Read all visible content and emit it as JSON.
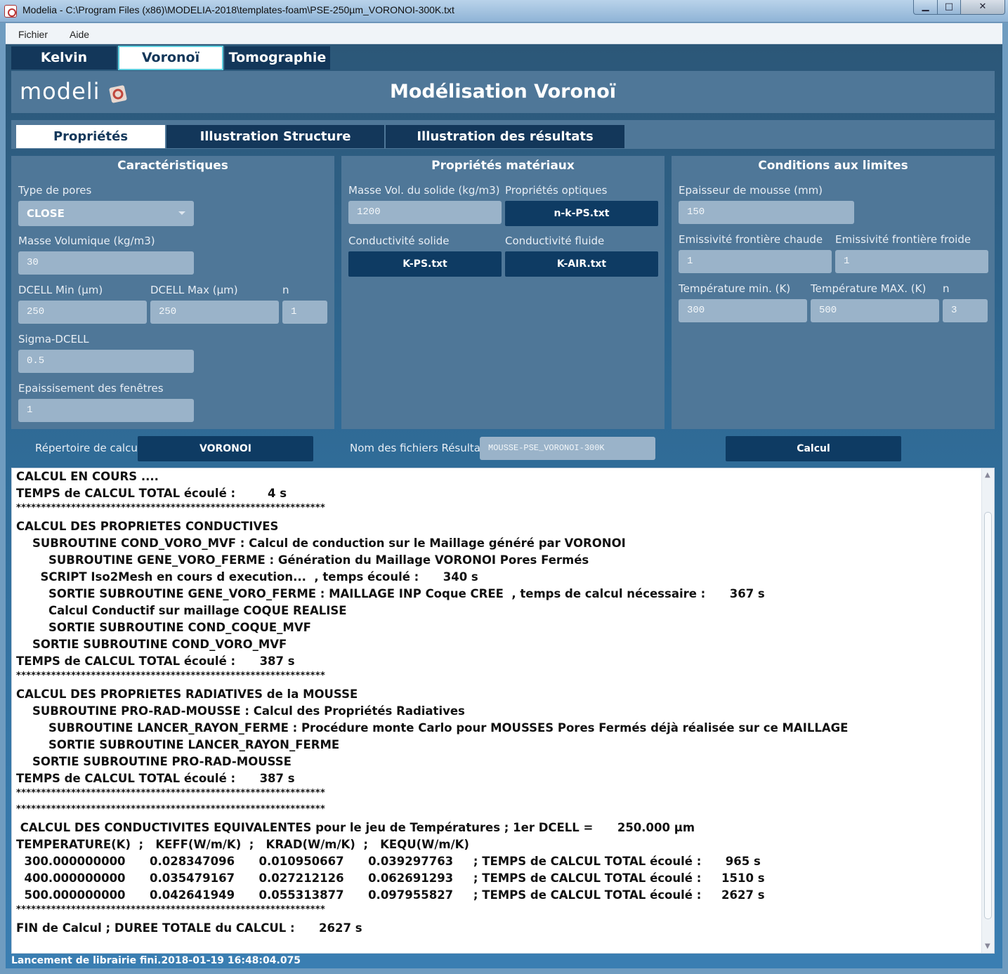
{
  "window": {
    "title": "Modelia - C:\\Program Files (x86)\\MODELIA-2018\\templates-foam\\PSE-250µm_VORONOI-300K.txt",
    "minimize": "▁",
    "maximize": "□",
    "close": "✕"
  },
  "menu": {
    "fichier": "Fichier",
    "aide": "Aide"
  },
  "top_tabs": {
    "kelvin": "Kelvin",
    "voronoi": "Voronoï",
    "tomographie": "Tomographie"
  },
  "header": {
    "logo_text": "modelia",
    "title": "Modélisation Voronoï"
  },
  "inner_tabs": {
    "proprietes": "Propriétés",
    "illustration_structure": "Illustration Structure",
    "illustration_resultats": "Illustration des résultats"
  },
  "caracteristiques": {
    "title": "Caractéristiques",
    "type_pores_label": "Type de pores",
    "type_pores_value": "CLOSE",
    "masse_vol_label": "Masse Volumique (kg/m3)",
    "masse_vol_value": "30",
    "dcell_min_label": "DCELL Min (µm)",
    "dcell_min_value": "250",
    "dcell_max_label": "DCELL Max (µm)",
    "dcell_max_value": "250",
    "n_label": "n",
    "n_value": "1",
    "sigma_label": "Sigma-DCELL",
    "sigma_value": "0.5",
    "epaississement_label": "Epaissisement des fenêtres",
    "epaississement_value": "1"
  },
  "materiaux": {
    "title": "Propriétés matériaux",
    "masse_vol_solide_label": "Masse Vol. du solide (kg/m3)",
    "masse_vol_solide_value": "1200",
    "optiques_label": "Propriétés optiques",
    "optiques_button": "n-k-PS.txt",
    "cond_solide_label": "Conductivité solide",
    "cond_solide_button": "K-PS.txt",
    "cond_fluide_label": "Conductivité fluide",
    "cond_fluide_button": "K-AIR.txt"
  },
  "conditions": {
    "title": "Conditions aux limites",
    "epaisseur_label": "Epaisseur de mousse (mm)",
    "epaisseur_value": "150",
    "emis_chaude_label": "Emissivité frontière chaude",
    "emis_chaude_value": "1",
    "emis_froide_label": "Emissivité frontière froide",
    "emis_froide_value": "1",
    "temp_min_label": "Température min. (K)",
    "temp_min_value": "300",
    "temp_max_label": "Température MAX. (K)",
    "temp_max_value": "500",
    "n_label": "n",
    "n_value": "3"
  },
  "bottom": {
    "repertoire_label": "Répertoire de calcul",
    "repertoire_button": "VORONOI",
    "nom_fichiers_label": "Nom des fichiers Résultat",
    "nom_fichiers_value": "MOUSSE-PSE_VORONOI-300K",
    "calcul_button": "Calcul"
  },
  "console_lines": [
    "CALCUL EN COURS ....",
    "TEMPS de CALCUL TOTAL écoulé :        4 s",
    "**************************************************************",
    "CALCUL DES PROPRIETES CONDUCTIVES",
    "    SUBROUTINE COND_VORO_MVF : Calcul de conduction sur le Maillage généré par VORONOI",
    "        SUBROUTINE GENE_VORO_FERME : Génération du Maillage VORONOI Pores Fermés",
    "      SCRIPT Iso2Mesh en cours d execution...  , temps écoulé :      340 s",
    "        SORTIE SUBROUTINE GENE_VORO_FERME : MAILLAGE INP Coque CREE  , temps de calcul nécessaire :      367 s",
    "        Calcul Conductif sur maillage COQUE REALISE",
    "        SORTIE SUBROUTINE COND_COQUE_MVF",
    "    SORTIE SUBROUTINE COND_VORO_MVF",
    "TEMPS de CALCUL TOTAL écoulé :      387 s",
    "**************************************************************",
    "CALCUL DES PROPRIETES RADIATIVES de la MOUSSE",
    "    SUBROUTINE PRO-RAD-MOUSSE : Calcul des Propriétés Radiatives",
    "        SUBROUTINE LANCER_RAYON_FERME : Procédure monte Carlo pour MOUSSES Pores Fermés déjà réalisée sur ce MAILLAGE",
    "        SORTIE SUBROUTINE LANCER_RAYON_FERME",
    "    SORTIE SUBROUTINE PRO-RAD-MOUSSE",
    "TEMPS de CALCUL TOTAL écoulé :      387 s",
    "**************************************************************",
    "**************************************************************",
    " CALCUL DES CONDUCTIVITES EQUIVALENTES pour le jeu de Températures ; 1er DCELL =      250.000 µm",
    "TEMPERATURE(K)  ;   KEFF(W/m/K)  ;   KRAD(W/m/K)  ;   KEQU(W/m/K)",
    "  300.000000000      0.028347096      0.010950667      0.039297763     ; TEMPS de CALCUL TOTAL écoulé :      965 s",
    "  400.000000000      0.035479167      0.027212126      0.062691293     ; TEMPS de CALCUL TOTAL écoulé :     1510 s",
    "  500.000000000      0.042641949      0.055313877      0.097955827     ; TEMPS de CALCUL TOTAL écoulé :     2627 s",
    "**************************************************************",
    "FIN de Calcul ; DUREE TOTALE du CALCUL :      2627 s"
  ],
  "statusbar": "Lancement de librairie fini.2018-01-19 16:48:04.075"
}
